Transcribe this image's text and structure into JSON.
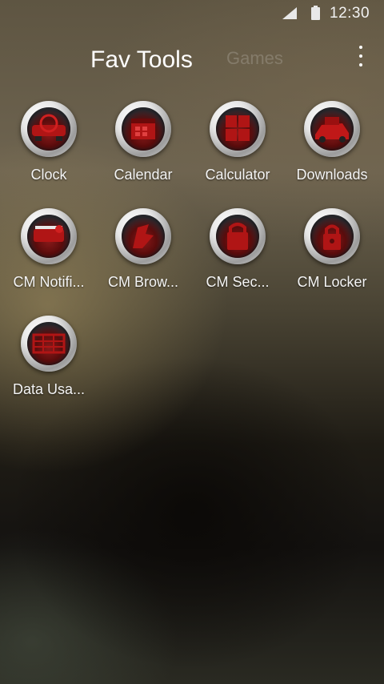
{
  "status_bar": {
    "time": "12:30",
    "signal_icon": "signal-icon",
    "battery_icon": "battery-icon"
  },
  "tabs": [
    {
      "label": "Fav Tools",
      "active": true
    },
    {
      "label": "Games",
      "active": false
    }
  ],
  "overflow_menu_icon": "more-vert-icon",
  "apps": [
    {
      "label": "Clock",
      "icon": "clock-icon"
    },
    {
      "label": "Calendar",
      "icon": "calendar-icon"
    },
    {
      "label": "Calculator",
      "icon": "calculator-icon"
    },
    {
      "label": "Downloads",
      "icon": "downloads-icon"
    },
    {
      "label": "CM Notifi...",
      "icon": "notification-icon"
    },
    {
      "label": "CM Brow...",
      "icon": "browser-icon"
    },
    {
      "label": "CM Sec...",
      "icon": "security-icon"
    },
    {
      "label": "CM Locker",
      "icon": "lock-icon"
    },
    {
      "label": "Data Usa...",
      "icon": "data-usage-icon"
    }
  ],
  "colors": {
    "icon_accent": "#b01515",
    "ring": "#e6e6e6"
  }
}
